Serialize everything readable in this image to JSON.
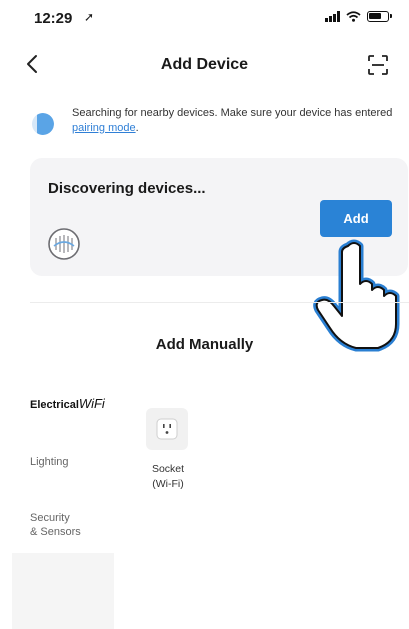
{
  "status_bar": {
    "time": "12:29",
    "location_arrow": "➚"
  },
  "nav": {
    "title": "Add Device",
    "back_icon": "chevron-left-icon",
    "scan_icon": "scan-frame-icon"
  },
  "hint": {
    "text_before": "Searching for nearby devices. Make sure your device has entered ",
    "link": "pairing mode",
    "text_after": "."
  },
  "discover": {
    "title": "Discovering devices...",
    "add_label": "Add"
  },
  "manual": {
    "title": "Add Manually"
  },
  "categories": {
    "electrical": "Electrical",
    "wifi": "WiFi",
    "lighting": "Lighting",
    "security_line1": "Security",
    "security_line2": "& Sensors"
  },
  "device": {
    "name_line1": "Socket",
    "name_line2": "(Wi-Fi)"
  },
  "colors": {
    "accent": "#2a83d6",
    "card_bg": "#f4f4f6"
  }
}
